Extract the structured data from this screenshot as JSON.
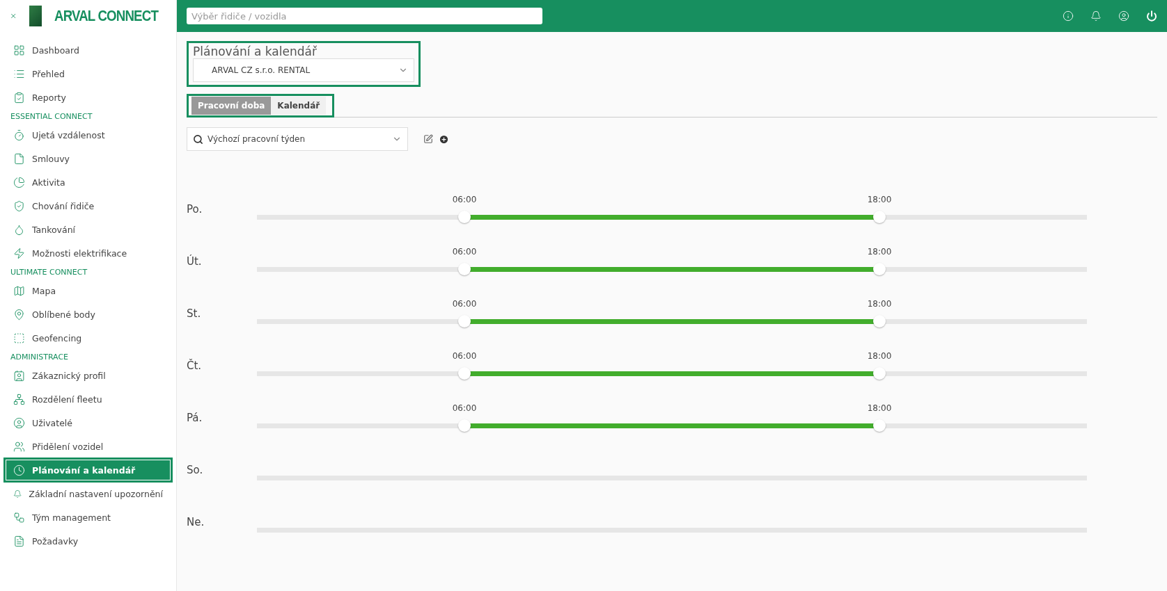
{
  "sidebar": {
    "brand": "ARVAL CONNECT",
    "groups": [
      {
        "items": [
          {
            "label": "Dashboard",
            "selected": false
          },
          {
            "label": "Přehled",
            "selected": false
          },
          {
            "label": "Reporty",
            "selected": false
          }
        ]
      },
      {
        "header": "ESSENTIAL CONNECT",
        "items": [
          {
            "label": "Ujetá vzdálenost",
            "selected": false
          },
          {
            "label": "Smlouvy",
            "selected": false
          },
          {
            "label": "Aktivita",
            "selected": false
          },
          {
            "label": "Chování řidiče",
            "selected": false
          },
          {
            "label": "Tankování",
            "selected": false
          },
          {
            "label": "Možnosti elektrifikace",
            "selected": false
          }
        ]
      },
      {
        "header": "ULTIMATE CONNECT",
        "items": [
          {
            "label": "Mapa",
            "selected": false
          },
          {
            "label": "Oblíbené body",
            "selected": false
          },
          {
            "label": "Geofencing",
            "selected": false
          }
        ]
      },
      {
        "header": "ADMINISTRACE",
        "items": [
          {
            "label": "Zákaznický profil",
            "selected": false
          },
          {
            "label": "Rozdělení fleetu",
            "selected": false
          },
          {
            "label": "Uživatelé",
            "selected": false
          },
          {
            "label": "Přidělení vozidel",
            "selected": false
          },
          {
            "label": "Plánování a kalendář",
            "selected": true
          },
          {
            "label": "Základní nastavení upozornění",
            "selected": false
          },
          {
            "label": "Tým management",
            "selected": false
          },
          {
            "label": "Požadavky",
            "selected": false
          }
        ]
      }
    ]
  },
  "topbar": {
    "search": {
      "placeholder": "Výběr řidiče / vozidla"
    }
  },
  "page": {
    "title": "Plánování a kalendář",
    "company_select": "ARVAL CZ s.r.o. RENTAL",
    "tabs": [
      {
        "label": "Pracovní doba",
        "selected": true
      },
      {
        "label": "Kalendář",
        "selected": false
      }
    ],
    "schedule_select": "Výchozí pracovní týden",
    "days": [
      {
        "label": "Po.",
        "thumbs": [
          {
            "time": "06:00",
            "level": 0.25
          },
          {
            "time": "18:00",
            "level": 0.75
          }
        ]
      },
      {
        "label": "Út.",
        "thumbs": [
          {
            "time": "06:00",
            "level": 0.25
          },
          {
            "time": "18:00",
            "level": 0.75
          }
        ]
      },
      {
        "label": "St.",
        "thumbs": [
          {
            "time": "06:00",
            "level": 0.25
          },
          {
            "time": "18:00",
            "level": 0.75
          }
        ]
      },
      {
        "label": "Čt.",
        "thumbs": [
          {
            "time": "06:00",
            "level": 0.25
          },
          {
            "time": "18:00",
            "level": 0.75
          }
        ]
      },
      {
        "label": "Pá.",
        "thumbs": [
          {
            "time": "06:00",
            "level": 0.25
          },
          {
            "time": "18:00",
            "level": 0.75
          }
        ]
      },
      {
        "label": "So."
      },
      {
        "label": "Ne."
      }
    ]
  }
}
